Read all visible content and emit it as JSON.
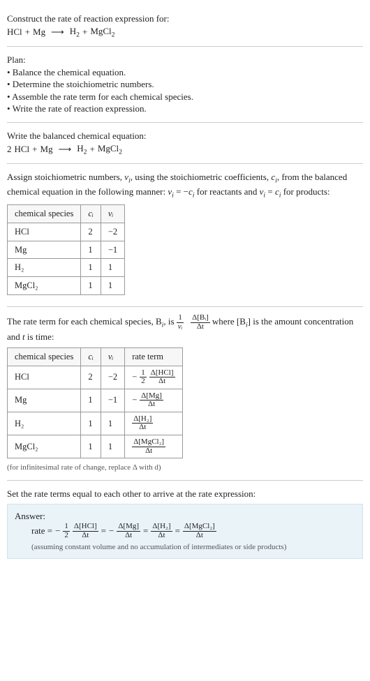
{
  "prompt": {
    "title": "Construct the rate of reaction expression for:",
    "equation_lhs1": "HCl",
    "equation_plus1": "+",
    "equation_lhs2": "Mg",
    "arrow": "⟶",
    "equation_rhs1": "H",
    "equation_rhs1_sub": "2",
    "equation_plus2": "+",
    "equation_rhs2": "MgCl",
    "equation_rhs2_sub": "2"
  },
  "plan": {
    "heading": "Plan:",
    "b1": "• Balance the chemical equation.",
    "b2": "• Determine the stoichiometric numbers.",
    "b3": "• Assemble the rate term for each chemical species.",
    "b4": "• Write the rate of reaction expression."
  },
  "balanced": {
    "heading": "Write the balanced chemical equation:",
    "coef1": "2",
    "lhs1": "HCl",
    "plus1": "+",
    "lhs2": "Mg",
    "arrow": "⟶",
    "rhs1": "H",
    "rhs1_sub": "2",
    "plus2": "+",
    "rhs2": "MgCl",
    "rhs2_sub": "2"
  },
  "stoich": {
    "intro1": "Assign stoichiometric numbers, ",
    "intro_nu": "ν",
    "intro_nu_sub": "i",
    "intro2": ", using the stoichiometric coefficients, ",
    "intro_c": "c",
    "intro_c_sub": "i",
    "intro3": ", from the balanced chemical equation in the following manner: ",
    "eq1_lhs": "ν",
    "eq1_lhs_sub": "i",
    "eq1_mid": " = −",
    "eq1_rhs": "c",
    "eq1_rhs_sub": "i",
    "intro4": " for reactants and ",
    "eq2_lhs": "ν",
    "eq2_lhs_sub": "i",
    "eq2_mid": " = ",
    "eq2_rhs": "c",
    "eq2_rhs_sub": "i",
    "intro5": " for products:",
    "headers": {
      "h1": "chemical species",
      "h2": "cᵢ",
      "h3": "νᵢ"
    },
    "rows": [
      {
        "species": "HCl",
        "c": "2",
        "nu": "−2"
      },
      {
        "species": "Mg",
        "c": "1",
        "nu": "−1"
      },
      {
        "species": "H₂",
        "c": "1",
        "nu": "1"
      },
      {
        "species": "MgCl₂",
        "c": "1",
        "nu": "1"
      }
    ]
  },
  "rateterm": {
    "intro1": "The rate term for each chemical species, B",
    "intro1_sub": "i",
    "intro2": ", is ",
    "frac1_num": "1",
    "frac1_den": "νᵢ",
    "frac2_num": "Δ[Bᵢ]",
    "frac2_den": "Δt",
    "intro3": " where [B",
    "intro3_sub": "i",
    "intro4": "] is the amount concentration and ",
    "intro_t": "t",
    "intro5": " is time:",
    "headers": {
      "h1": "chemical species",
      "h2": "cᵢ",
      "h3": "νᵢ",
      "h4": "rate term"
    },
    "rows": [
      {
        "species": "HCl",
        "c": "2",
        "nu": "−2",
        "neg": "−",
        "fnum": "1",
        "fden": "2",
        "dnum": "Δ[HCl]",
        "dden": "Δt"
      },
      {
        "species": "Mg",
        "c": "1",
        "nu": "−1",
        "neg": "−",
        "fnum": "",
        "fden": "",
        "dnum": "Δ[Mg]",
        "dden": "Δt"
      },
      {
        "species": "H₂",
        "c": "1",
        "nu": "1",
        "neg": "",
        "fnum": "",
        "fden": "",
        "dnum": "Δ[H₂]",
        "dden": "Δt"
      },
      {
        "species": "MgCl₂",
        "c": "1",
        "nu": "1",
        "neg": "",
        "fnum": "",
        "fden": "",
        "dnum": "Δ[MgCl₂]",
        "dden": "Δt"
      }
    ],
    "note": "(for infinitesimal rate of change, replace Δ with d)"
  },
  "final": {
    "heading": "Set the rate terms equal to each other to arrive at the rate expression:",
    "answer_label": "Answer:",
    "rate_label": "rate = ",
    "neg": "−",
    "f1num": "1",
    "f1den": "2",
    "t1num": "Δ[HCl]",
    "t1den": "Δt",
    "eq": " = ",
    "t2num": "Δ[Mg]",
    "t2den": "Δt",
    "t3num": "Δ[H₂]",
    "t3den": "Δt",
    "t4num": "Δ[MgCl₂]",
    "t4den": "Δt",
    "assumption": "(assuming constant volume and no accumulation of intermediates or side products)"
  }
}
